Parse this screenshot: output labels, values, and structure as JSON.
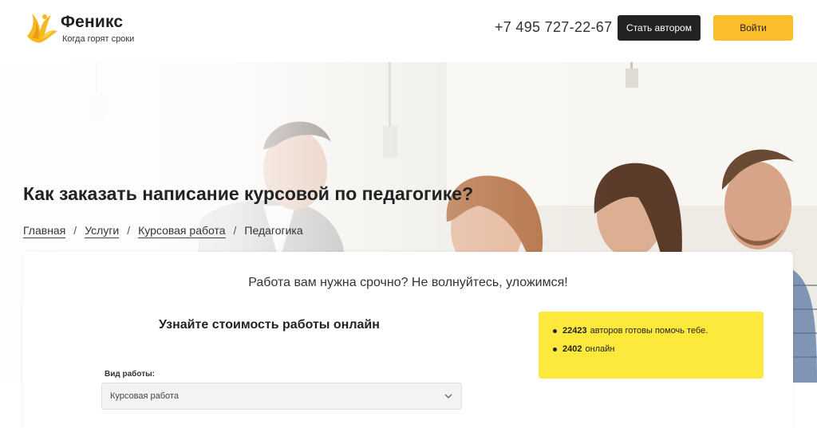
{
  "header": {
    "brand_name": "Феникс",
    "brand_tagline": "Когда горят сроки",
    "logo_icon": "phoenix-icon",
    "phone": "+7 495 727-22-67",
    "author_button": "Стать автором",
    "login_button": "Войти"
  },
  "hero": {
    "title": "Как заказать написание курсовой по педагогике?",
    "breadcrumbs": [
      "Главная",
      "Услуги",
      "Курсовая работа"
    ],
    "breadcrumb_current": "Педагогика",
    "separator": "/"
  },
  "card": {
    "subtitle": "Работа вам нужна срочно? Не волнуйтесь, уложимся!",
    "form_title": "Узнайте стоимость работы онлайн",
    "work_type_label": "Вид работы:",
    "work_type_value": "Курсовая работа",
    "info": [
      {
        "number": "22423",
        "text": "авторов готовы помочь тебе."
      },
      {
        "number": "2402",
        "text": "онлайн"
      }
    ]
  },
  "colors": {
    "accent_yellow": "#fbbd2c",
    "info_yellow": "#fde93c",
    "dark_button": "#222222"
  }
}
